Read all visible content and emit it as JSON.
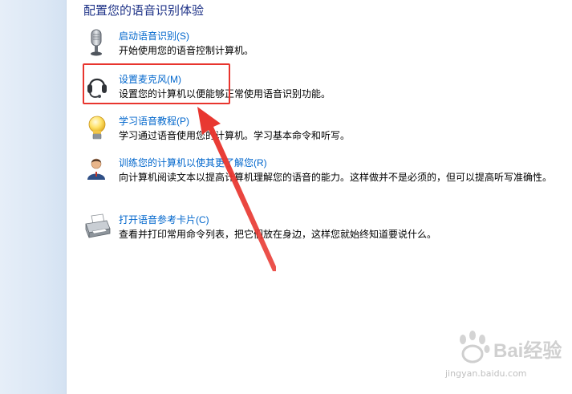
{
  "page": {
    "heading": "配置您的语音识别体验"
  },
  "tasks": [
    {
      "link": "启动语音识别(S)",
      "desc": "开始使用您的语音控制计算机。",
      "icon": "microphone-icon"
    },
    {
      "link": "设置麦克风(M)",
      "desc": "设置您的计算机以便能够正常使用语音识别功能。",
      "icon": "headset-icon"
    },
    {
      "link": "学习语音教程(P)",
      "desc": "学习通过语音使用您的计算机。学习基本命令和听写。",
      "icon": "lightbulb-icon"
    },
    {
      "link": "训练您的计算机以使其更了解您(R)",
      "desc": "向计算机阅读文本以提高计算机理解您的语音的能力。这样做并不是必须的，但可以提高听写准确性。",
      "icon": "user-training-icon"
    },
    {
      "link": "打开语音参考卡片(C)",
      "desc": "查看并打印常用命令列表，把它们放在身边，这样您就始终知道要说什么。",
      "icon": "printer-icon"
    }
  ],
  "annotation": {
    "color": "#e8352e"
  },
  "watermark": {
    "brand": "Bai经验",
    "url": "jingyan.baidu.com"
  }
}
